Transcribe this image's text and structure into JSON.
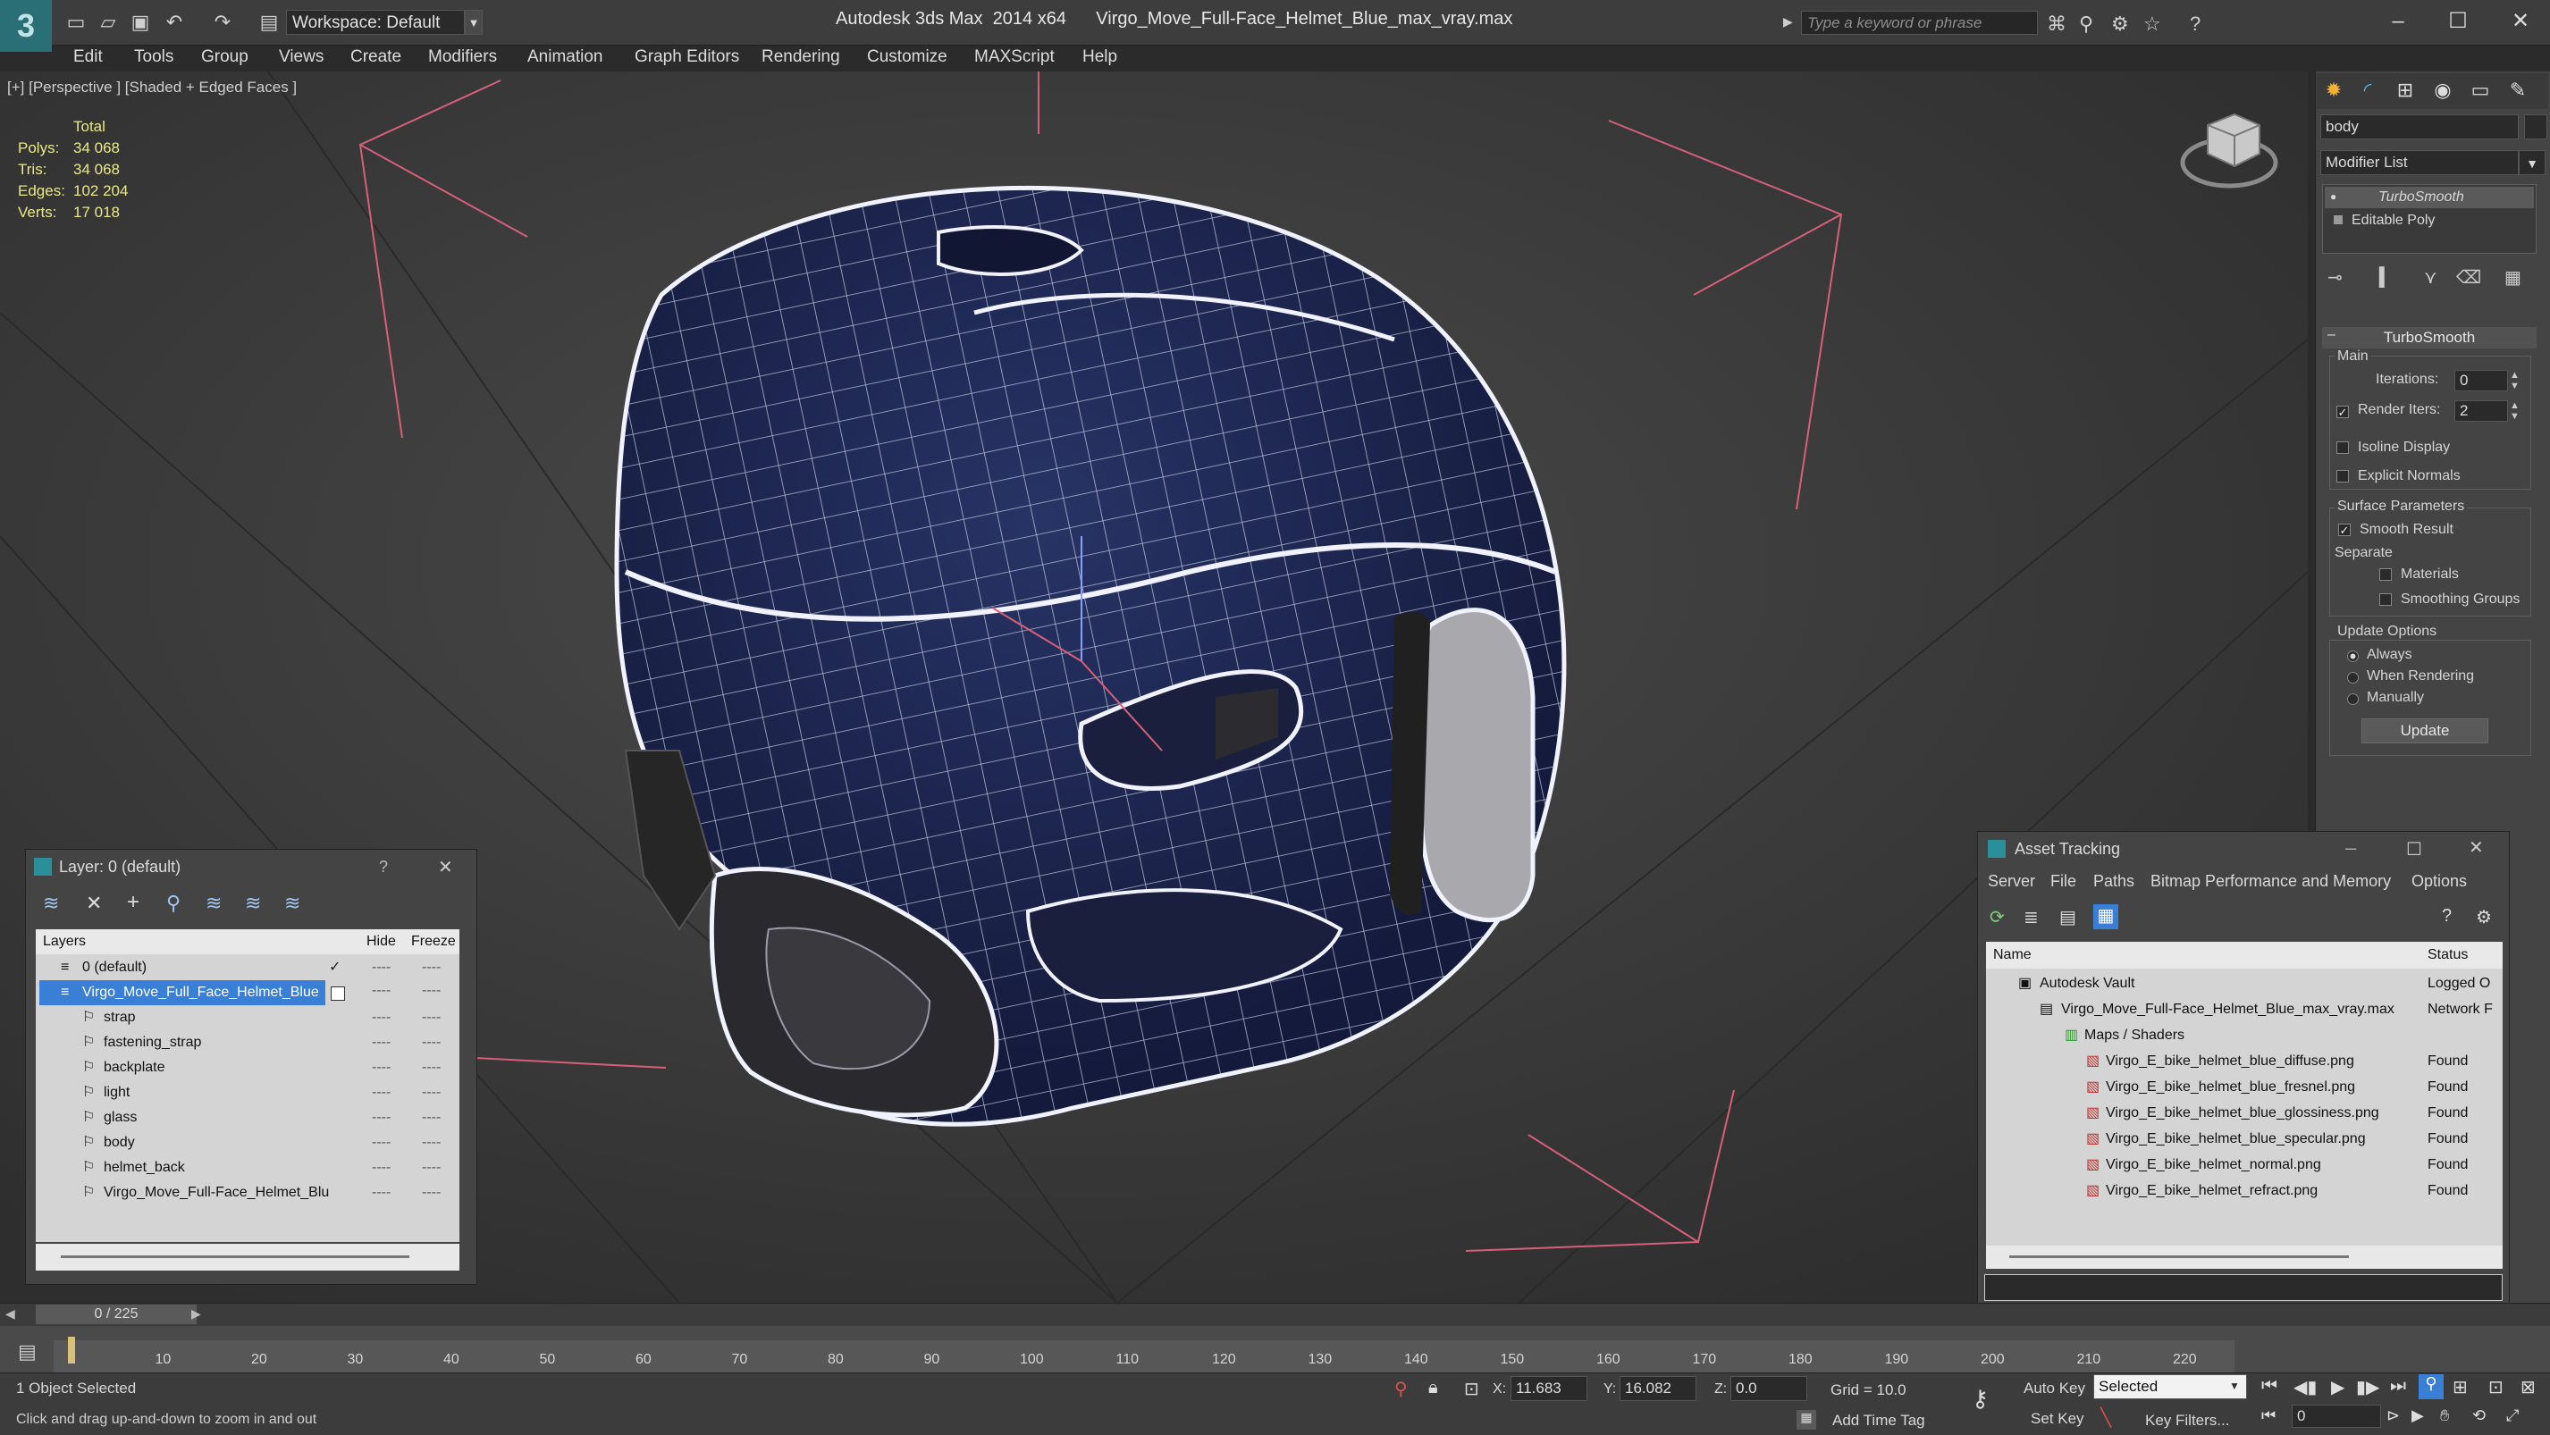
{
  "app": {
    "title": "Autodesk 3ds Max  2014 x64      Virgo_Move_Full-Face_Helmet_Blue_max_vray.max",
    "workspace": "Workspace: Default",
    "search_placeholder": "Type a keyword or phrase",
    "logo": "3"
  },
  "menu": [
    "Edit",
    "Tools",
    "Group",
    "Views",
    "Create",
    "Modifiers",
    "Animation",
    "Graph Editors",
    "Rendering",
    "Customize",
    "MAXScript",
    "Help"
  ],
  "viewport": {
    "label": "[+] [Perspective ] [Shaded + Edged Faces ]",
    "stats": {
      "header": "Total",
      "rows": [
        {
          "k": "Polys:",
          "v": "34 068"
        },
        {
          "k": "Tris:",
          "v": "34 068"
        },
        {
          "k": "Edges:",
          "v": "102 204"
        },
        {
          "k": "Verts:",
          "v": "17 018"
        }
      ]
    }
  },
  "command_panel": {
    "object_name": "body",
    "modifier_list": "Modifier List",
    "stack": [
      "TurboSmooth",
      "Editable Poly"
    ],
    "rollout_title": "TurboSmooth",
    "main_label": "Main",
    "iterations_label": "Iterations:",
    "iterations_value": "0",
    "render_iters_label": "Render Iters:",
    "render_iters_value": "2",
    "isoline": "Isoline Display",
    "explicit": "Explicit Normals",
    "surface_params": "Surface Parameters",
    "smooth_result": "Smooth Result",
    "separate": "Separate",
    "materials": "Materials",
    "smoothing_groups": "Smoothing Groups",
    "update_options": "Update Options",
    "always": "Always",
    "when_rendering": "When Rendering",
    "manually": "Manually",
    "update_btn": "Update"
  },
  "layer_panel": {
    "title": "Layer: 0 (default)",
    "help": "?",
    "close": "✕",
    "col_layers": "Layers",
    "col_hide": "Hide",
    "col_freeze": "Freeze",
    "rows": [
      {
        "name": "0 (default)",
        "indent": 0
      },
      {
        "name": "Virgo_Move_Full_Face_Helmet_Blue",
        "indent": 0
      },
      {
        "name": "strap",
        "indent": 1
      },
      {
        "name": "fastening_strap",
        "indent": 1
      },
      {
        "name": "backplate",
        "indent": 1
      },
      {
        "name": "light",
        "indent": 1
      },
      {
        "name": "glass",
        "indent": 1
      },
      {
        "name": "body",
        "indent": 1
      },
      {
        "name": "helmet_back",
        "indent": 1
      },
      {
        "name": "Virgo_Move_Full-Face_Helmet_Blu",
        "indent": 1
      }
    ]
  },
  "asset_panel": {
    "title": "Asset Tracking",
    "menu": [
      "Server",
      "File",
      "Paths",
      "Bitmap Performance and Memory",
      "Options"
    ],
    "col_name": "Name",
    "col_status": "Status",
    "rows": [
      {
        "name": "Autodesk Vault",
        "status": "Logged O",
        "indent": 1
      },
      {
        "name": "Virgo_Move_Full-Face_Helmet_Blue_max_vray.max",
        "status": "Network F",
        "indent": 2
      },
      {
        "name": "Maps / Shaders",
        "status": "",
        "indent": 3
      },
      {
        "name": "Virgo_E_bike_helmet_blue_diffuse.png",
        "status": "Found",
        "indent": 4
      },
      {
        "name": "Virgo_E_bike_helmet_blue_fresnel.png",
        "status": "Found",
        "indent": 4
      },
      {
        "name": "Virgo_E_bike_helmet_blue_glossiness.png",
        "status": "Found",
        "indent": 4
      },
      {
        "name": "Virgo_E_bike_helmet_blue_specular.png",
        "status": "Found",
        "indent": 4
      },
      {
        "name": "Virgo_E_bike_helmet_normal.png",
        "status": "Found",
        "indent": 4
      },
      {
        "name": "Virgo_E_bike_helmet_refract.png",
        "status": "Found",
        "indent": 4
      }
    ]
  },
  "timeline": {
    "frame": "0 / 225",
    "ticks": [
      "10",
      "20",
      "30",
      "40",
      "50",
      "60",
      "70",
      "80",
      "90",
      "100",
      "110",
      "120",
      "130",
      "140",
      "150",
      "160",
      "170",
      "180",
      "190",
      "200",
      "210",
      "220"
    ]
  },
  "status": {
    "selected": "1 Object Selected",
    "hint": "Click and drag up-and-down to zoom in and out",
    "x_label": "X:",
    "x_value": "11.683",
    "y_label": "Y:",
    "y_value": "16.082",
    "z_label": "Z:",
    "z_value": "0.0",
    "grid": "Grid = 10.0",
    "add_time_tag": "Add Time Tag",
    "auto_key": "Auto Key",
    "set_key": "Set Key",
    "selected_dd": "Selected",
    "key_filters": "Key Filters...",
    "frame_value": "0"
  },
  "colors": {
    "helmet": "#1b2352",
    "selection": "#3a7fd6",
    "gizmo": "#d6607a"
  }
}
